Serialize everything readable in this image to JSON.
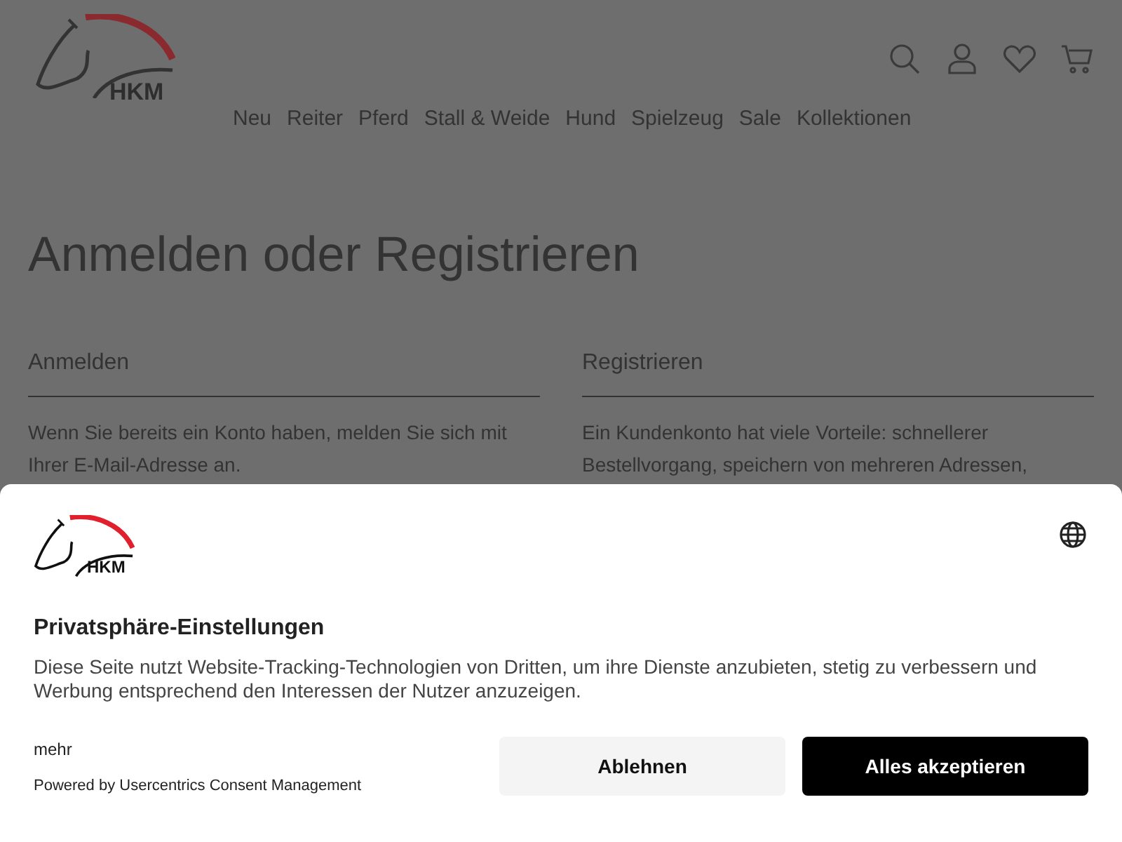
{
  "header": {
    "logo_text": "HKM",
    "nav": [
      "Neu",
      "Reiter",
      "Pferd",
      "Stall & Weide",
      "Hund",
      "Spielzeug",
      "Sale",
      "Kollektionen"
    ]
  },
  "page_title": "Anmelden oder Registrieren",
  "sections": [
    {
      "heading": "Anmelden",
      "text": "Wenn Sie bereits ein Konto haben, melden Sie sich mit Ihrer E-Mail-Adresse an."
    },
    {
      "heading": "Registrieren",
      "text": "Ein Kundenkonto hat viele Vorteile: schnellerer Bestellvorgang, speichern von mehreren Adressen,"
    }
  ],
  "consent": {
    "logo_text": "HKM",
    "title": "Privatsphäre-Einstellungen",
    "text": "Diese Seite nutzt Website-Tracking-Technologien von Dritten, um ihre Dienste anzubieten, stetig zu verbessern und Werbung entsprechend den Interessen der Nutzer anzuzeigen.",
    "more_link": "mehr",
    "powered_by": "Powered by Usercentrics Consent Management",
    "buttons": [
      {
        "label": "Ablehnen",
        "kind": "secondary"
      },
      {
        "label": "Alles akzeptieren",
        "kind": "primary"
      }
    ]
  }
}
